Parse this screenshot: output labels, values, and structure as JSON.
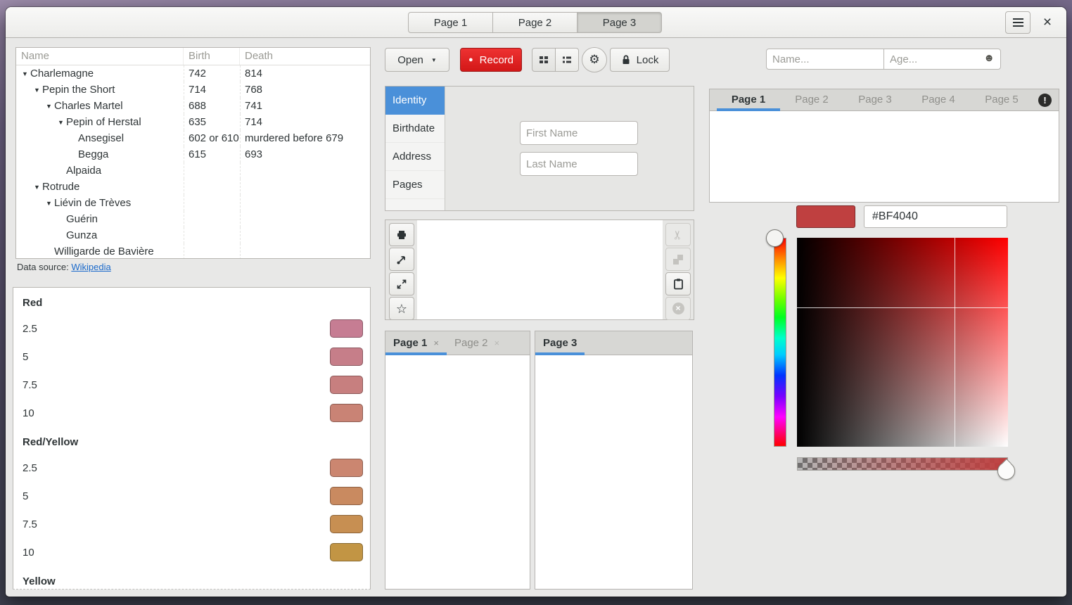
{
  "header": {
    "tabs": [
      {
        "label": "Page 1"
      },
      {
        "label": "Page 2"
      },
      {
        "label": "Page 3"
      }
    ],
    "active_tab": "Page 3"
  },
  "family_tree": {
    "columns": {
      "name": "Name",
      "birth": "Birth",
      "death": "Death"
    },
    "rows": [
      {
        "name": "Charlemagne",
        "birth": "742",
        "death": "814"
      },
      {
        "name": "Pepin the Short",
        "birth": "714",
        "death": "768"
      },
      {
        "name": "Charles Martel",
        "birth": "688",
        "death": "741"
      },
      {
        "name": "Pepin of Herstal",
        "birth": "635",
        "death": "714"
      },
      {
        "name": "Ansegisel",
        "birth": "602 or 610",
        "death": "murdered before 679"
      },
      {
        "name": "Begga",
        "birth": "615",
        "death": "693"
      },
      {
        "name": "Alpaida",
        "birth": "",
        "death": ""
      },
      {
        "name": "Rotrude",
        "birth": "",
        "death": ""
      },
      {
        "name": "Liévin de Trèves",
        "birth": "",
        "death": ""
      },
      {
        "name": "Guérin",
        "birth": "",
        "death": ""
      },
      {
        "name": "Gunza",
        "birth": "",
        "death": ""
      },
      {
        "name": "Willigarde de Bavière",
        "birth": "",
        "death": ""
      }
    ],
    "source_prefix": "Data source:",
    "source_link": "Wikipedia"
  },
  "palette": {
    "sections": [
      {
        "title": "Red",
        "items": [
          {
            "label": "2.5",
            "color": "#C67D93"
          },
          {
            "label": "5",
            "color": "#C67E89"
          },
          {
            "label": "7.5",
            "color": "#C77F7F"
          },
          {
            "label": "10",
            "color": "#C98375"
          }
        ]
      },
      {
        "title": "Red/Yellow",
        "items": [
          {
            "label": "2.5",
            "color": "#CB8670"
          },
          {
            "label": "5",
            "color": "#C98A60"
          },
          {
            "label": "7.5",
            "color": "#C78F52"
          },
          {
            "label": "10",
            "color": "#C29544"
          }
        ]
      },
      {
        "title": "Yellow",
        "items": []
      }
    ]
  },
  "toolbar": {
    "open_label": "Open",
    "record_label": "Record",
    "lock_label": "Lock"
  },
  "stack_sidebar": {
    "items": [
      {
        "label": "Identity"
      },
      {
        "label": "Birthdate"
      },
      {
        "label": "Address"
      },
      {
        "label": "Pages"
      }
    ],
    "active": "Identity"
  },
  "identity_form": {
    "first_name_placeholder": "First Name",
    "last_name_placeholder": "Last Name"
  },
  "notebooks": {
    "bottom_left": {
      "tabs": [
        {
          "label": "Page 1"
        },
        {
          "label": "Page 2"
        }
      ],
      "active": "Page 1"
    },
    "bottom_right": {
      "tabs": [
        {
          "label": "Page 3"
        }
      ],
      "active": "Page 3"
    }
  },
  "people_bar": {
    "name_placeholder": "Name...",
    "age_placeholder": "Age..."
  },
  "pages_notebook": {
    "tabs": [
      {
        "label": "Page 1"
      },
      {
        "label": "Page 2"
      },
      {
        "label": "Page 3"
      },
      {
        "label": "Page 4"
      },
      {
        "label": "Page 5"
      }
    ],
    "active": "Page 1",
    "warning_glyph": "!"
  },
  "color_editor": {
    "hex": "#BF4040",
    "swatch_color": "#BF4040"
  },
  "icons": {
    "menu": "hamburger",
    "close": "×",
    "dropdown": "▼",
    "record_dot": "●",
    "gear": "⚙",
    "star": "☆",
    "scissors": "✂",
    "smiley": "☻",
    "tab_close": "×",
    "expander": "▼"
  },
  "colors": {
    "accent_blue": "#4A90D9",
    "record_red": "#D31717",
    "link_blue": "#1B6ACB",
    "picked_color": "#BF4040"
  }
}
